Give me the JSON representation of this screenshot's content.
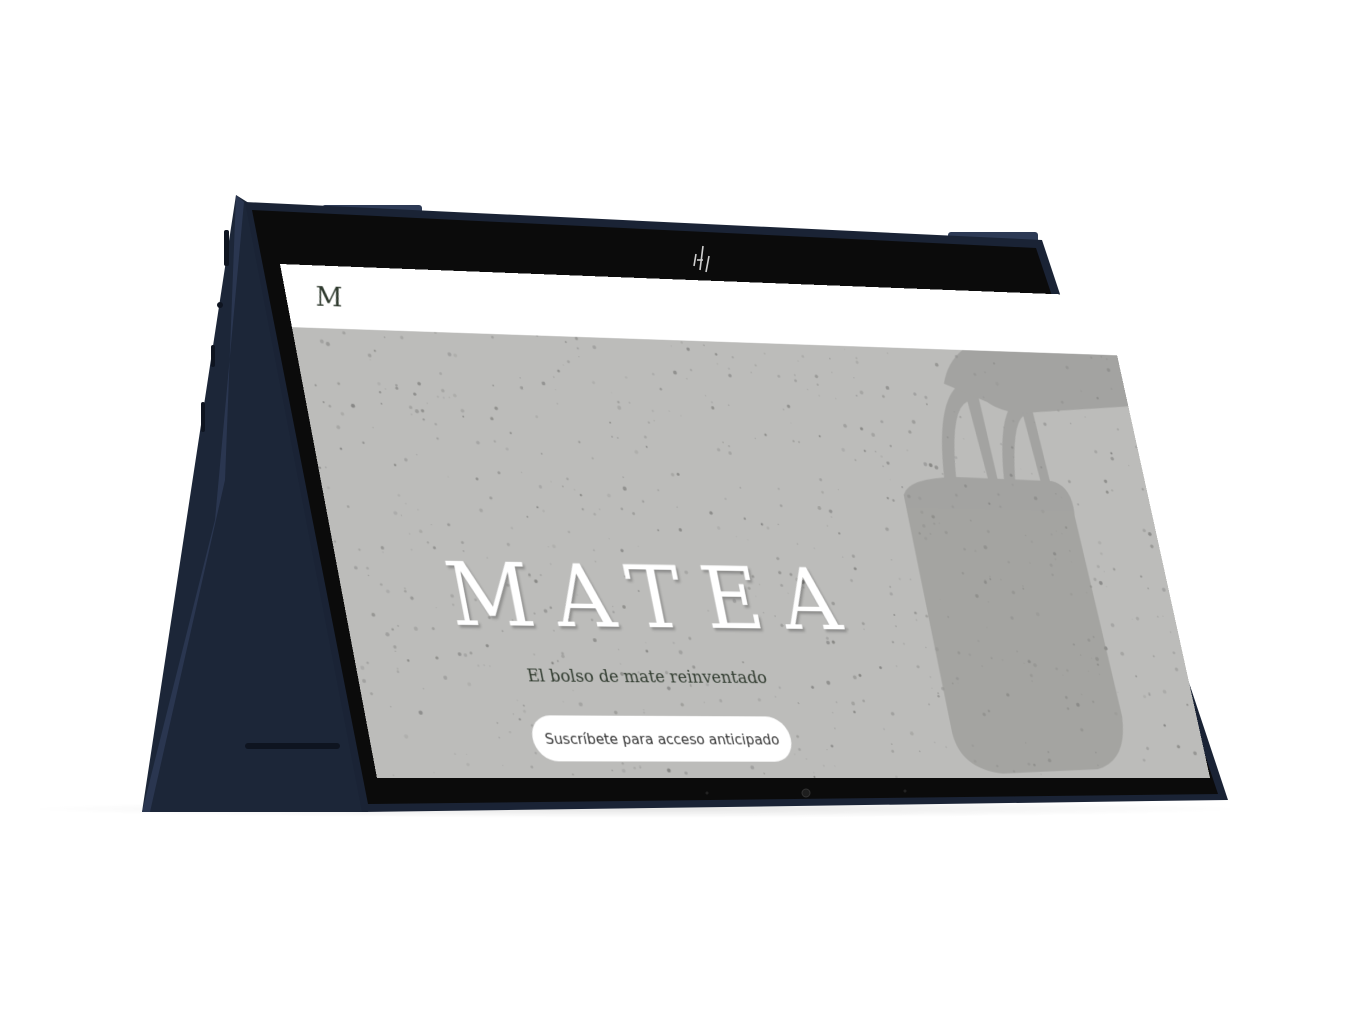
{
  "device": {
    "brand_logo": "hp-logo-icon",
    "body_color": "#1c2638"
  },
  "site": {
    "logo_text": "M",
    "hero": {
      "title": "MATEA",
      "subtitle": "El bolso de mate reinventado",
      "cta_label": "Suscríbete para acceso anticipado"
    },
    "colors": {
      "header_bg": "#ffffff",
      "hero_bg": "#bcbcba",
      "text_dark": "#2f3a2e",
      "bag_shadow": "#8f8f8d"
    }
  }
}
